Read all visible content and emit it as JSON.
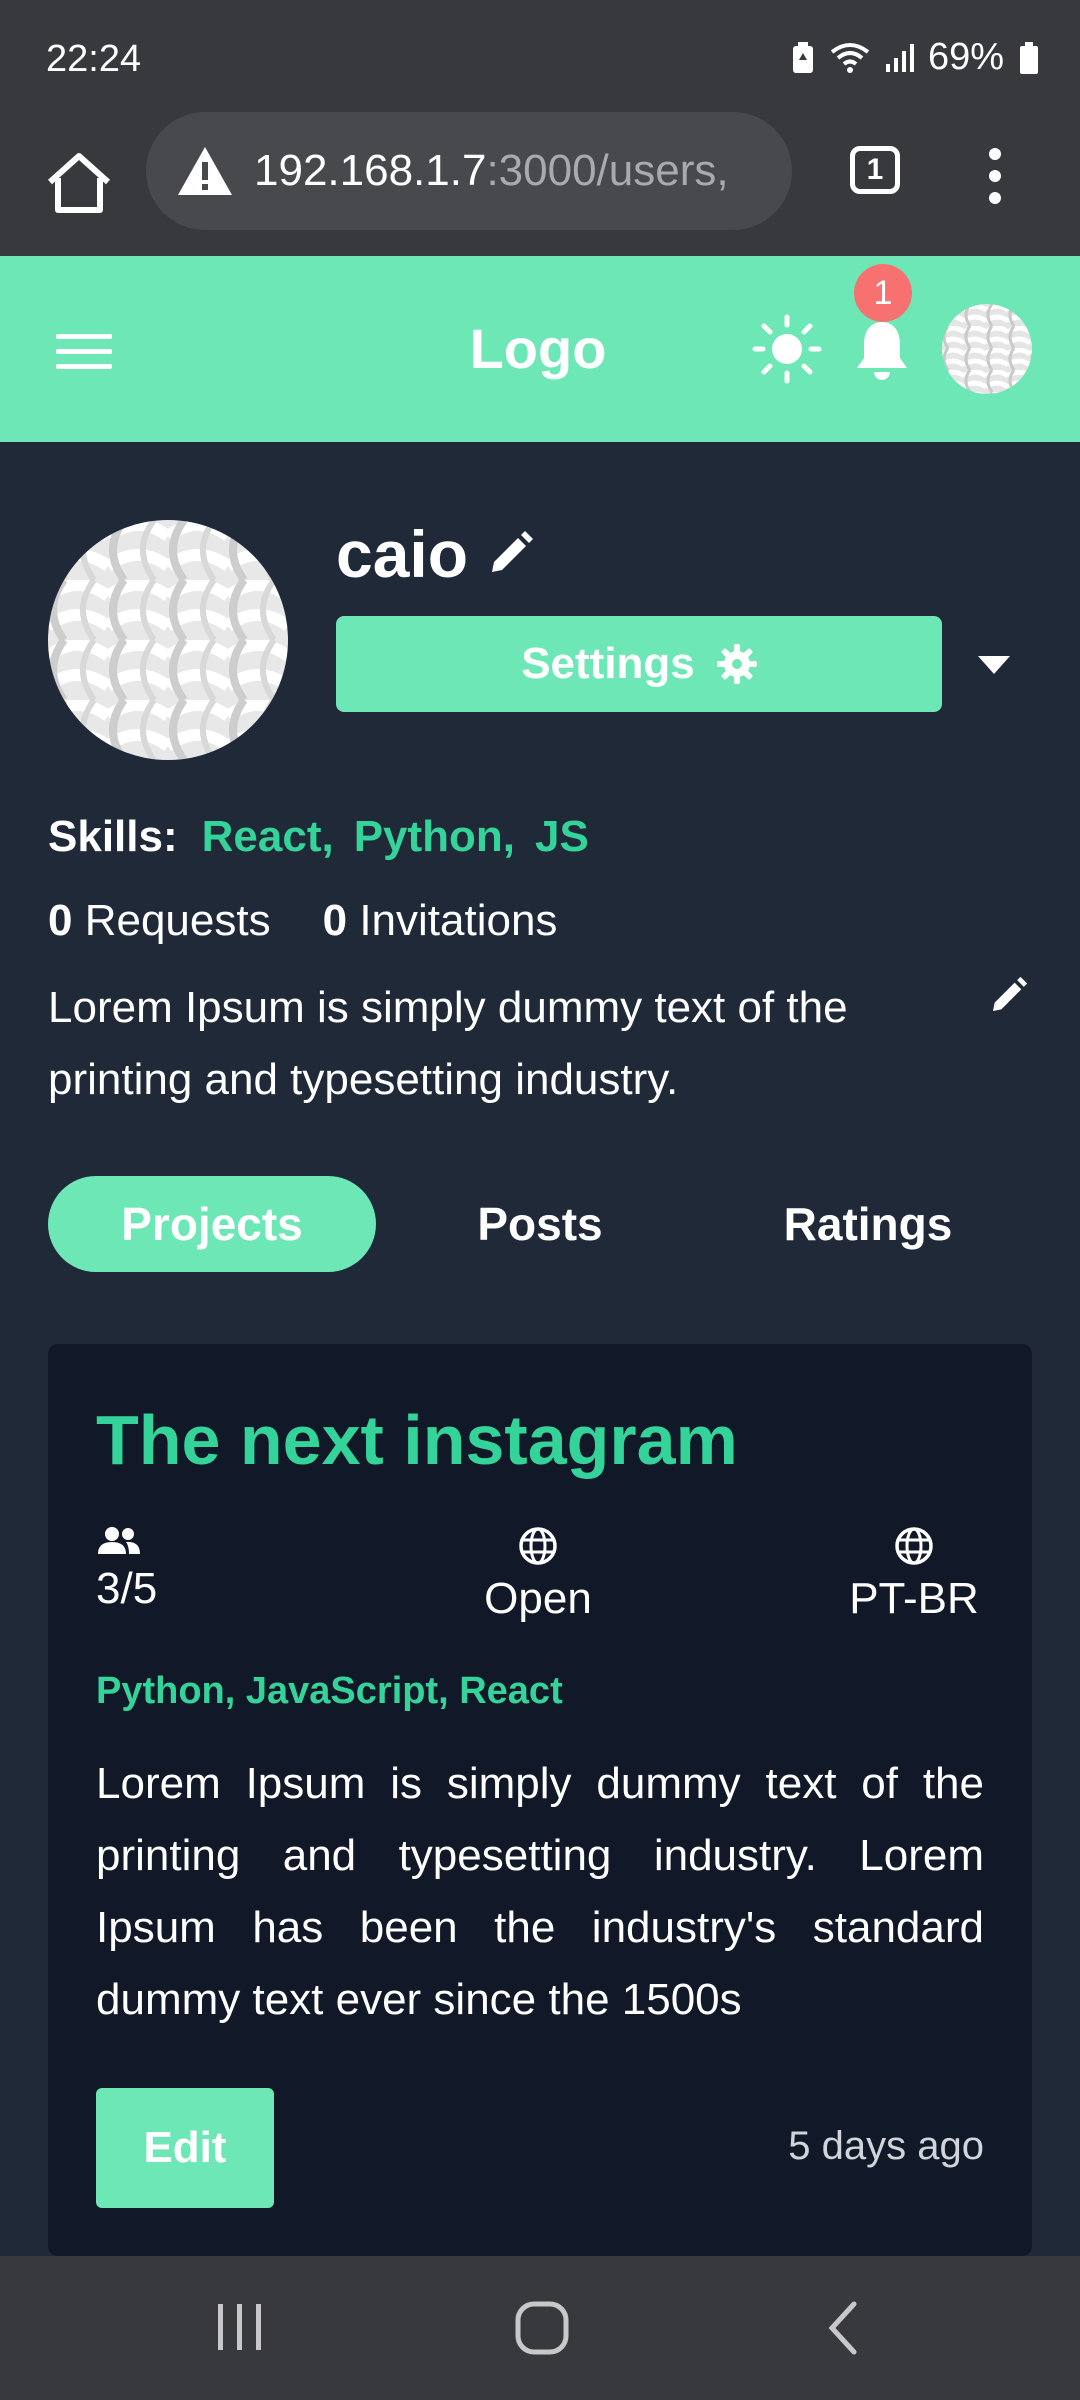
{
  "status_bar": {
    "time": "22:24",
    "battery": "69%"
  },
  "browser": {
    "url_host": "192.168.1.7",
    "url_rest": ":3000/users,",
    "tab_count": "1"
  },
  "header": {
    "logo": "Logo",
    "notification_count": "1"
  },
  "profile": {
    "username": "caio",
    "settings_label": "Settings",
    "skills_label": "Skills:",
    "skills": [
      "React,",
      "Python,",
      "JS"
    ],
    "requests_count": "0",
    "requests_label": "Requests",
    "invitations_count": "0",
    "invitations_label": "Invitations",
    "bio": "Lorem Ipsum is simply dummy text of the printing and typesetting industry."
  },
  "tabs": [
    {
      "label": "Projects",
      "active": true
    },
    {
      "label": "Posts",
      "active": false
    },
    {
      "label": "Ratings",
      "active": false
    }
  ],
  "project_card": {
    "title": "The next instagram",
    "members": "3/5",
    "status": "Open",
    "language": "PT-BR",
    "technologies": "Python, JavaScript, React",
    "description": "Lorem Ipsum is simply dummy text of the printing and typesetting industry. Lorem Ipsum has been the industry's standard dummy text ever since the 1500s",
    "edit_label": "Edit",
    "time_ago": "5 days ago"
  },
  "colors": {
    "accent": "#6ee7b7",
    "accent_text": "#34d399",
    "background": "#1f2937",
    "card": "#111827",
    "badge": "#f87171"
  }
}
